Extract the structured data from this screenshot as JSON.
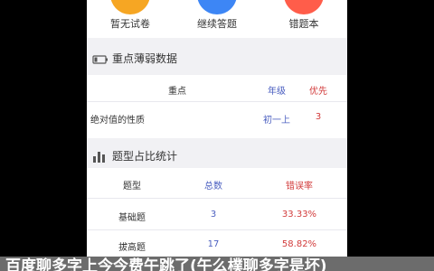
{
  "quick_buttons": [
    {
      "label": "暂无试卷",
      "color": "#f6a623",
      "icon": "paper-icon"
    },
    {
      "label": "继续答题",
      "color": "#3d86f5",
      "icon": "continue-icon"
    },
    {
      "label": "错题本",
      "color": "#ff5d4a",
      "icon": "wrong-book-icon"
    }
  ],
  "weak_section": {
    "title": "重点薄弱数据",
    "icon": "battery-icon",
    "headers": {
      "point": "重点",
      "grade": "年级",
      "priority": "优先"
    },
    "rows": [
      {
        "point": "绝对值的性质",
        "grade": "初一上",
        "priority": "3"
      }
    ]
  },
  "stats_section": {
    "title": "题型占比统计",
    "icon": "bar-chart-icon",
    "headers": {
      "type": "题型",
      "total": "总数",
      "error_rate": "错误率"
    },
    "rows": [
      {
        "type": "基础题",
        "total": "3",
        "error_rate": "33.33%"
      },
      {
        "type": "拔高题",
        "total": "17",
        "error_rate": "58.82%"
      }
    ]
  },
  "caption": "百度聊多字上今今费午跳了(午么樸聊多字是坏)",
  "colors": {
    "accent_blue": "#4b5fc0",
    "accent_red": "#d23b3b"
  }
}
